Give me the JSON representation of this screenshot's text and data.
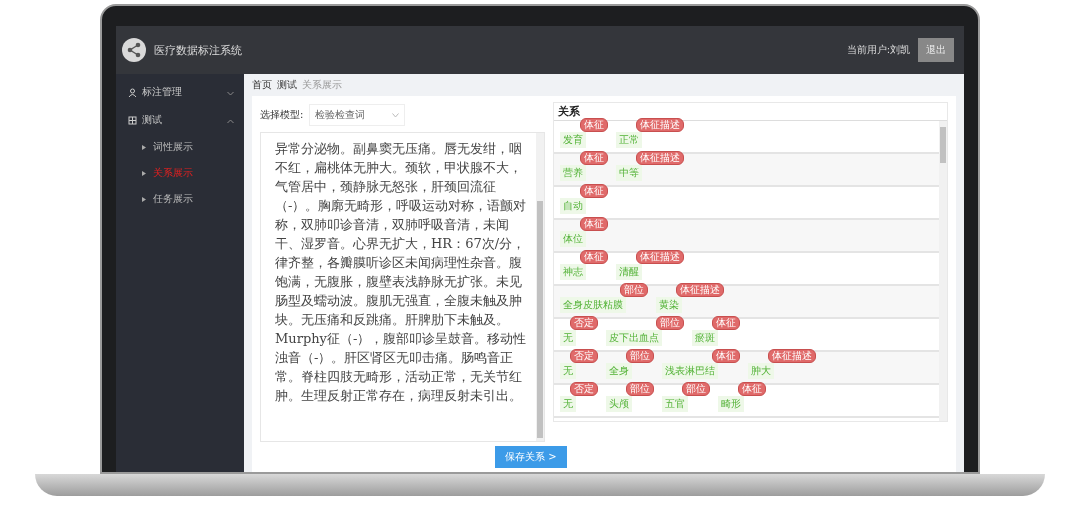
{
  "header": {
    "title": "医疗数据标注系统",
    "user": "当前用户:刘凯",
    "logout": "退出"
  },
  "sidebar": {
    "items": [
      {
        "label": "标注管理",
        "expanded": false
      },
      {
        "label": "测试",
        "expanded": true,
        "children": [
          {
            "label": "词性展示",
            "selected": false
          },
          {
            "label": "关系展示",
            "selected": true
          },
          {
            "label": "任务展示",
            "selected": false
          }
        ]
      }
    ]
  },
  "breadcrumb": [
    "首页",
    "测试",
    "关系展示"
  ],
  "model_select": {
    "label": "选择模型:",
    "value": "检验检查词"
  },
  "document": {
    "text": "异常分泌物。副鼻窦无压痛。唇无发绀，咽不红，扁桃体无肿大。颈软，甲状腺不大，气管居中，颈静脉无怒张，肝颈回流征（-）。胸廓无畸形，呼吸运动对称，语颤对称，双肺叩诊音清，双肺呼吸音清，未闻干、湿罗音。心界无扩大，HR：67次/分，律齐整，各瓣膜听诊区未闻病理性杂音。腹饱满，无腹胀，腹壁表浅静脉无扩张。未见肠型及蠕动波。腹肌无强直，全腹未触及肿块。无压痛和反跳痛。肝脾肋下未触及。Murphy征（-），腹部叩诊呈鼓音。移动性浊音（-）。肝区肾区无叩击痛。肠鸣音正常。脊柱四肢无畸形，活动正常，无关节红肿。生理反射正常存在，病理反射未引出。"
  },
  "relations": {
    "title": "关系",
    "rows": [
      [
        {
          "text": "发育",
          "badge": "体征"
        },
        {
          "text": "正常",
          "badge": "体征描述"
        }
      ],
      [
        {
          "text": "营养",
          "badge": "体征"
        },
        {
          "text": "中等",
          "badge": "体征描述"
        }
      ],
      [
        {
          "text": "自动",
          "badge": "体征"
        }
      ],
      [
        {
          "text": "体位",
          "badge": "体征"
        }
      ],
      [
        {
          "text": "神志",
          "badge": "体征"
        },
        {
          "text": "清醒",
          "badge": "体征描述"
        }
      ],
      [
        {
          "text": "全身皮肤粘膜",
          "badge": "部位"
        },
        {
          "text": "黄染",
          "badge": "体征描述"
        }
      ],
      [
        {
          "text": "无",
          "badge": "否定"
        },
        {
          "text": "皮下出血点",
          "badge": "部位"
        },
        {
          "text": "瘀斑",
          "badge": "体征"
        }
      ],
      [
        {
          "text": "无",
          "badge": "否定"
        },
        {
          "text": "全身",
          "badge": "部位"
        },
        {
          "text": "浅表淋巴结",
          "badge": "体征"
        },
        {
          "text": "肿大",
          "badge": "体征描述"
        }
      ],
      [
        {
          "text": "无",
          "badge": "否定"
        },
        {
          "text": "头颅",
          "badge": "部位"
        },
        {
          "text": "五官",
          "badge": "部位"
        },
        {
          "text": "畸形",
          "badge": "体征"
        }
      ]
    ]
  },
  "submit_button": "保存关系 >"
}
